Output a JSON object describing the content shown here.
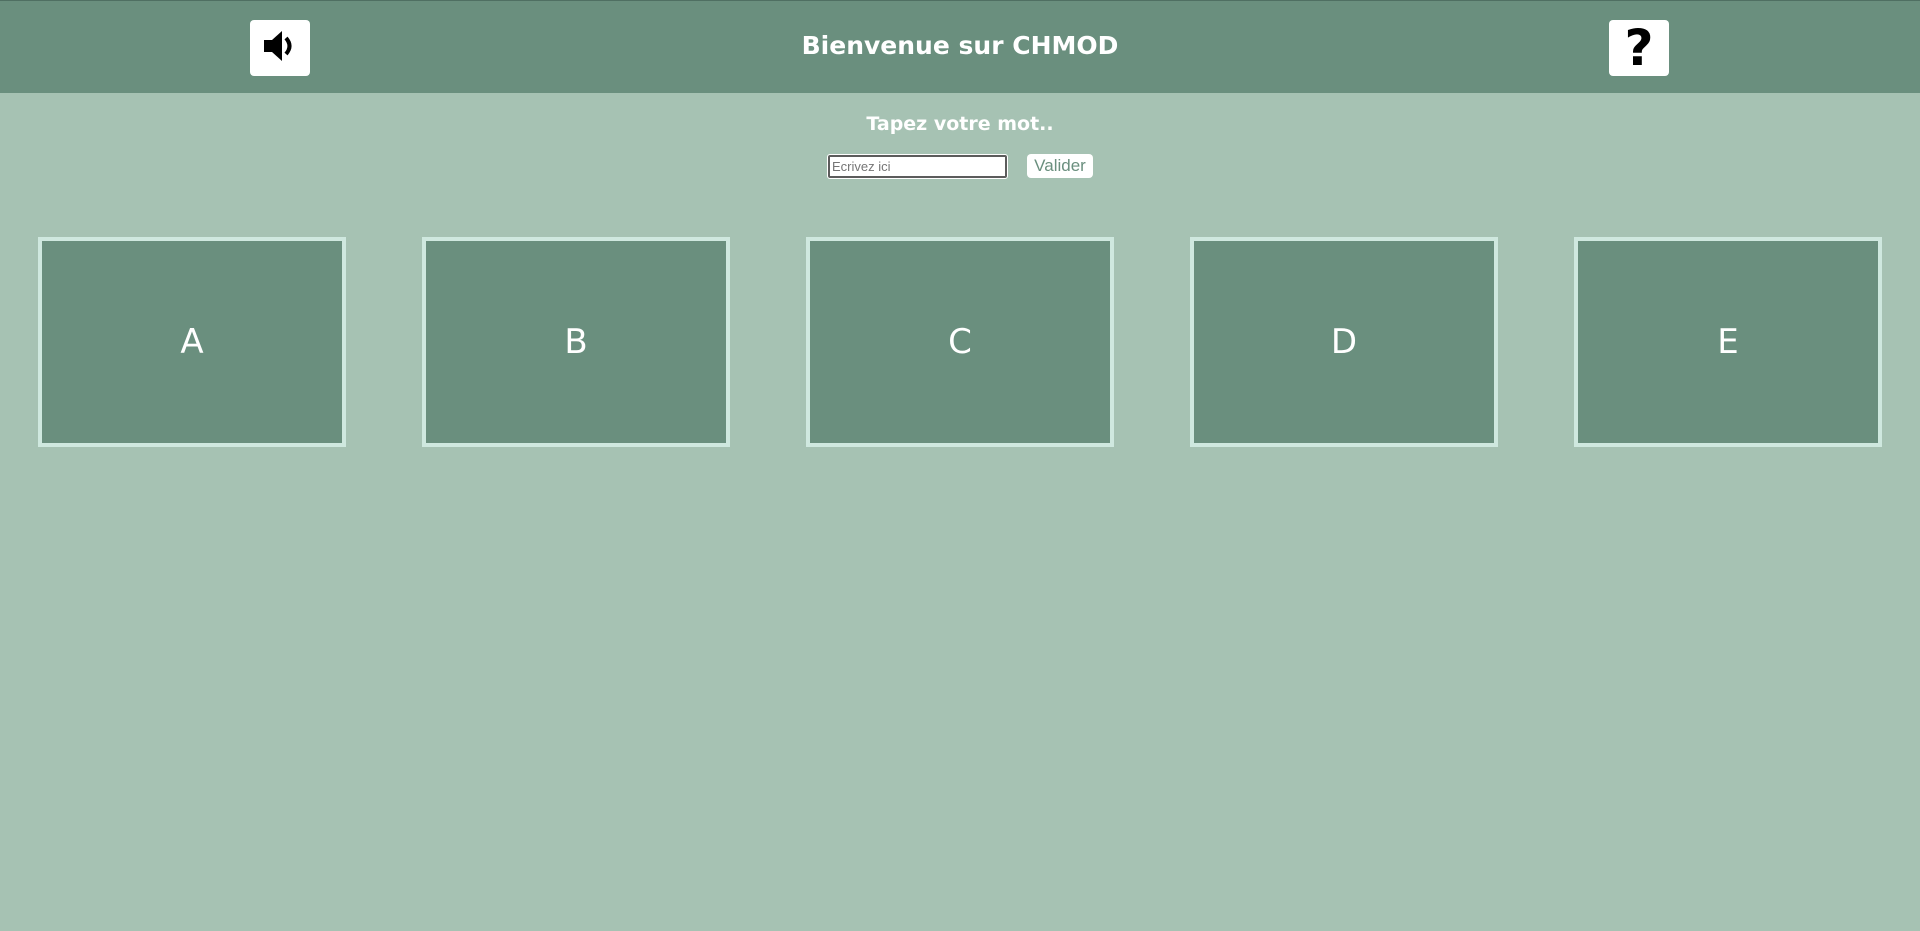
{
  "header": {
    "title": "Bienvenue sur CHMOD",
    "sound_icon": "speaker-icon",
    "help_icon": "question-mark-icon",
    "help_glyph": "?"
  },
  "form": {
    "prompt": "Tapez votre mot..",
    "input_value": "",
    "input_placeholder": "Ecrivez ici",
    "submit_label": "Valider"
  },
  "cards": [
    {
      "label": "A"
    },
    {
      "label": "B"
    },
    {
      "label": "C"
    },
    {
      "label": "D"
    },
    {
      "label": "E"
    }
  ],
  "colors": {
    "background": "#a6c2b3",
    "header": "#6a8f7e",
    "card_fill": "#6a8f7e",
    "card_border": "#cfe8df",
    "text": "#ffffff"
  }
}
